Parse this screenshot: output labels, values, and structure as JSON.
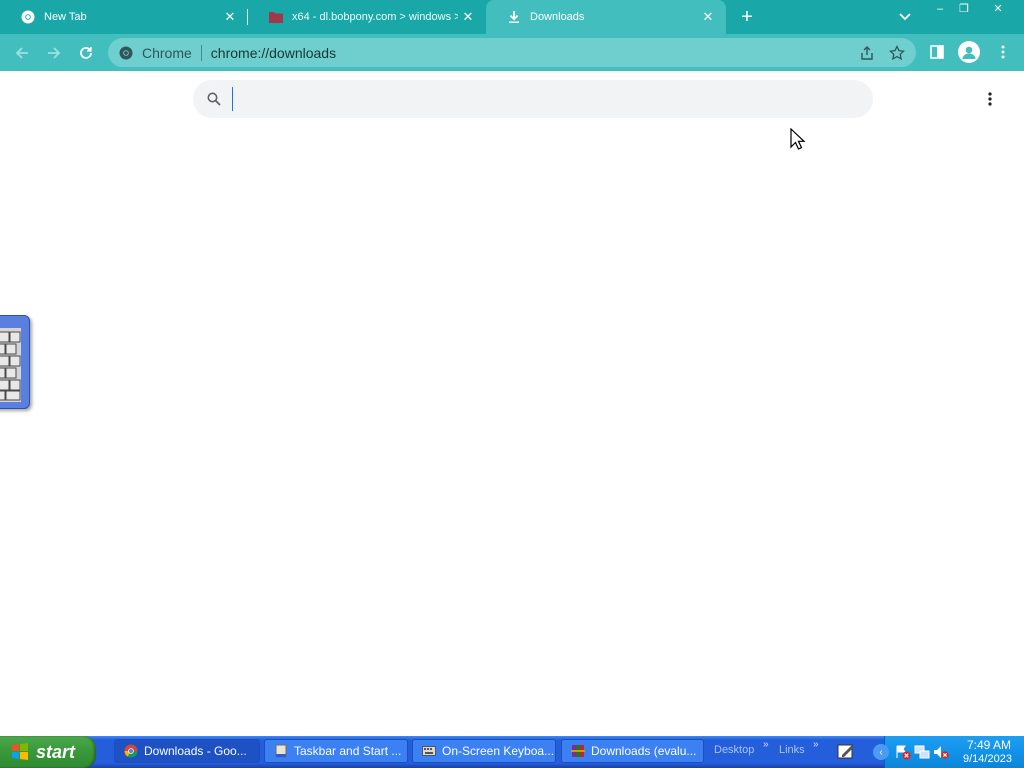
{
  "browser": {
    "tabs": [
      {
        "title": "New Tab",
        "icon": "chrome-icon",
        "active": false
      },
      {
        "title": "x64 - dl.bobpony.com > windows >",
        "icon": "folder-icon",
        "active": false
      },
      {
        "title": "Downloads",
        "icon": "download-icon",
        "active": true
      }
    ],
    "new_tab_label": "+",
    "window_controls": {
      "minimize": "–",
      "maximize": "❐",
      "close": "✕"
    }
  },
  "toolbar": {
    "omnibox_chip": "Chrome",
    "omnibox_url": "chrome://downloads"
  },
  "downloads_page": {
    "search_value": "",
    "search_placeholder": ""
  },
  "taskbar": {
    "start_label": "start",
    "tasks": [
      {
        "label": "Downloads - Goo...",
        "icon": "chrome-icon"
      },
      {
        "label": "Taskbar and Start ...",
        "icon": "taskbar-properties-icon"
      },
      {
        "label": "On-Screen Keyboa...",
        "icon": "keyboard-icon"
      },
      {
        "label": "Downloads (evalu...",
        "icon": "winrar-icon"
      }
    ],
    "toolbar_desktop": "Desktop",
    "toolbar_links": "Links",
    "chevron": "»",
    "clock_time": "7:49 AM",
    "clock_date": "9/14/2023"
  },
  "colors": {
    "tabstrip": "#1aa7a7",
    "toolbar": "#42bebe",
    "omnibox": "#6fcfcf",
    "taskbar": "#245edb",
    "start_button": "#3c9a3c",
    "tray": "#1193e9"
  }
}
